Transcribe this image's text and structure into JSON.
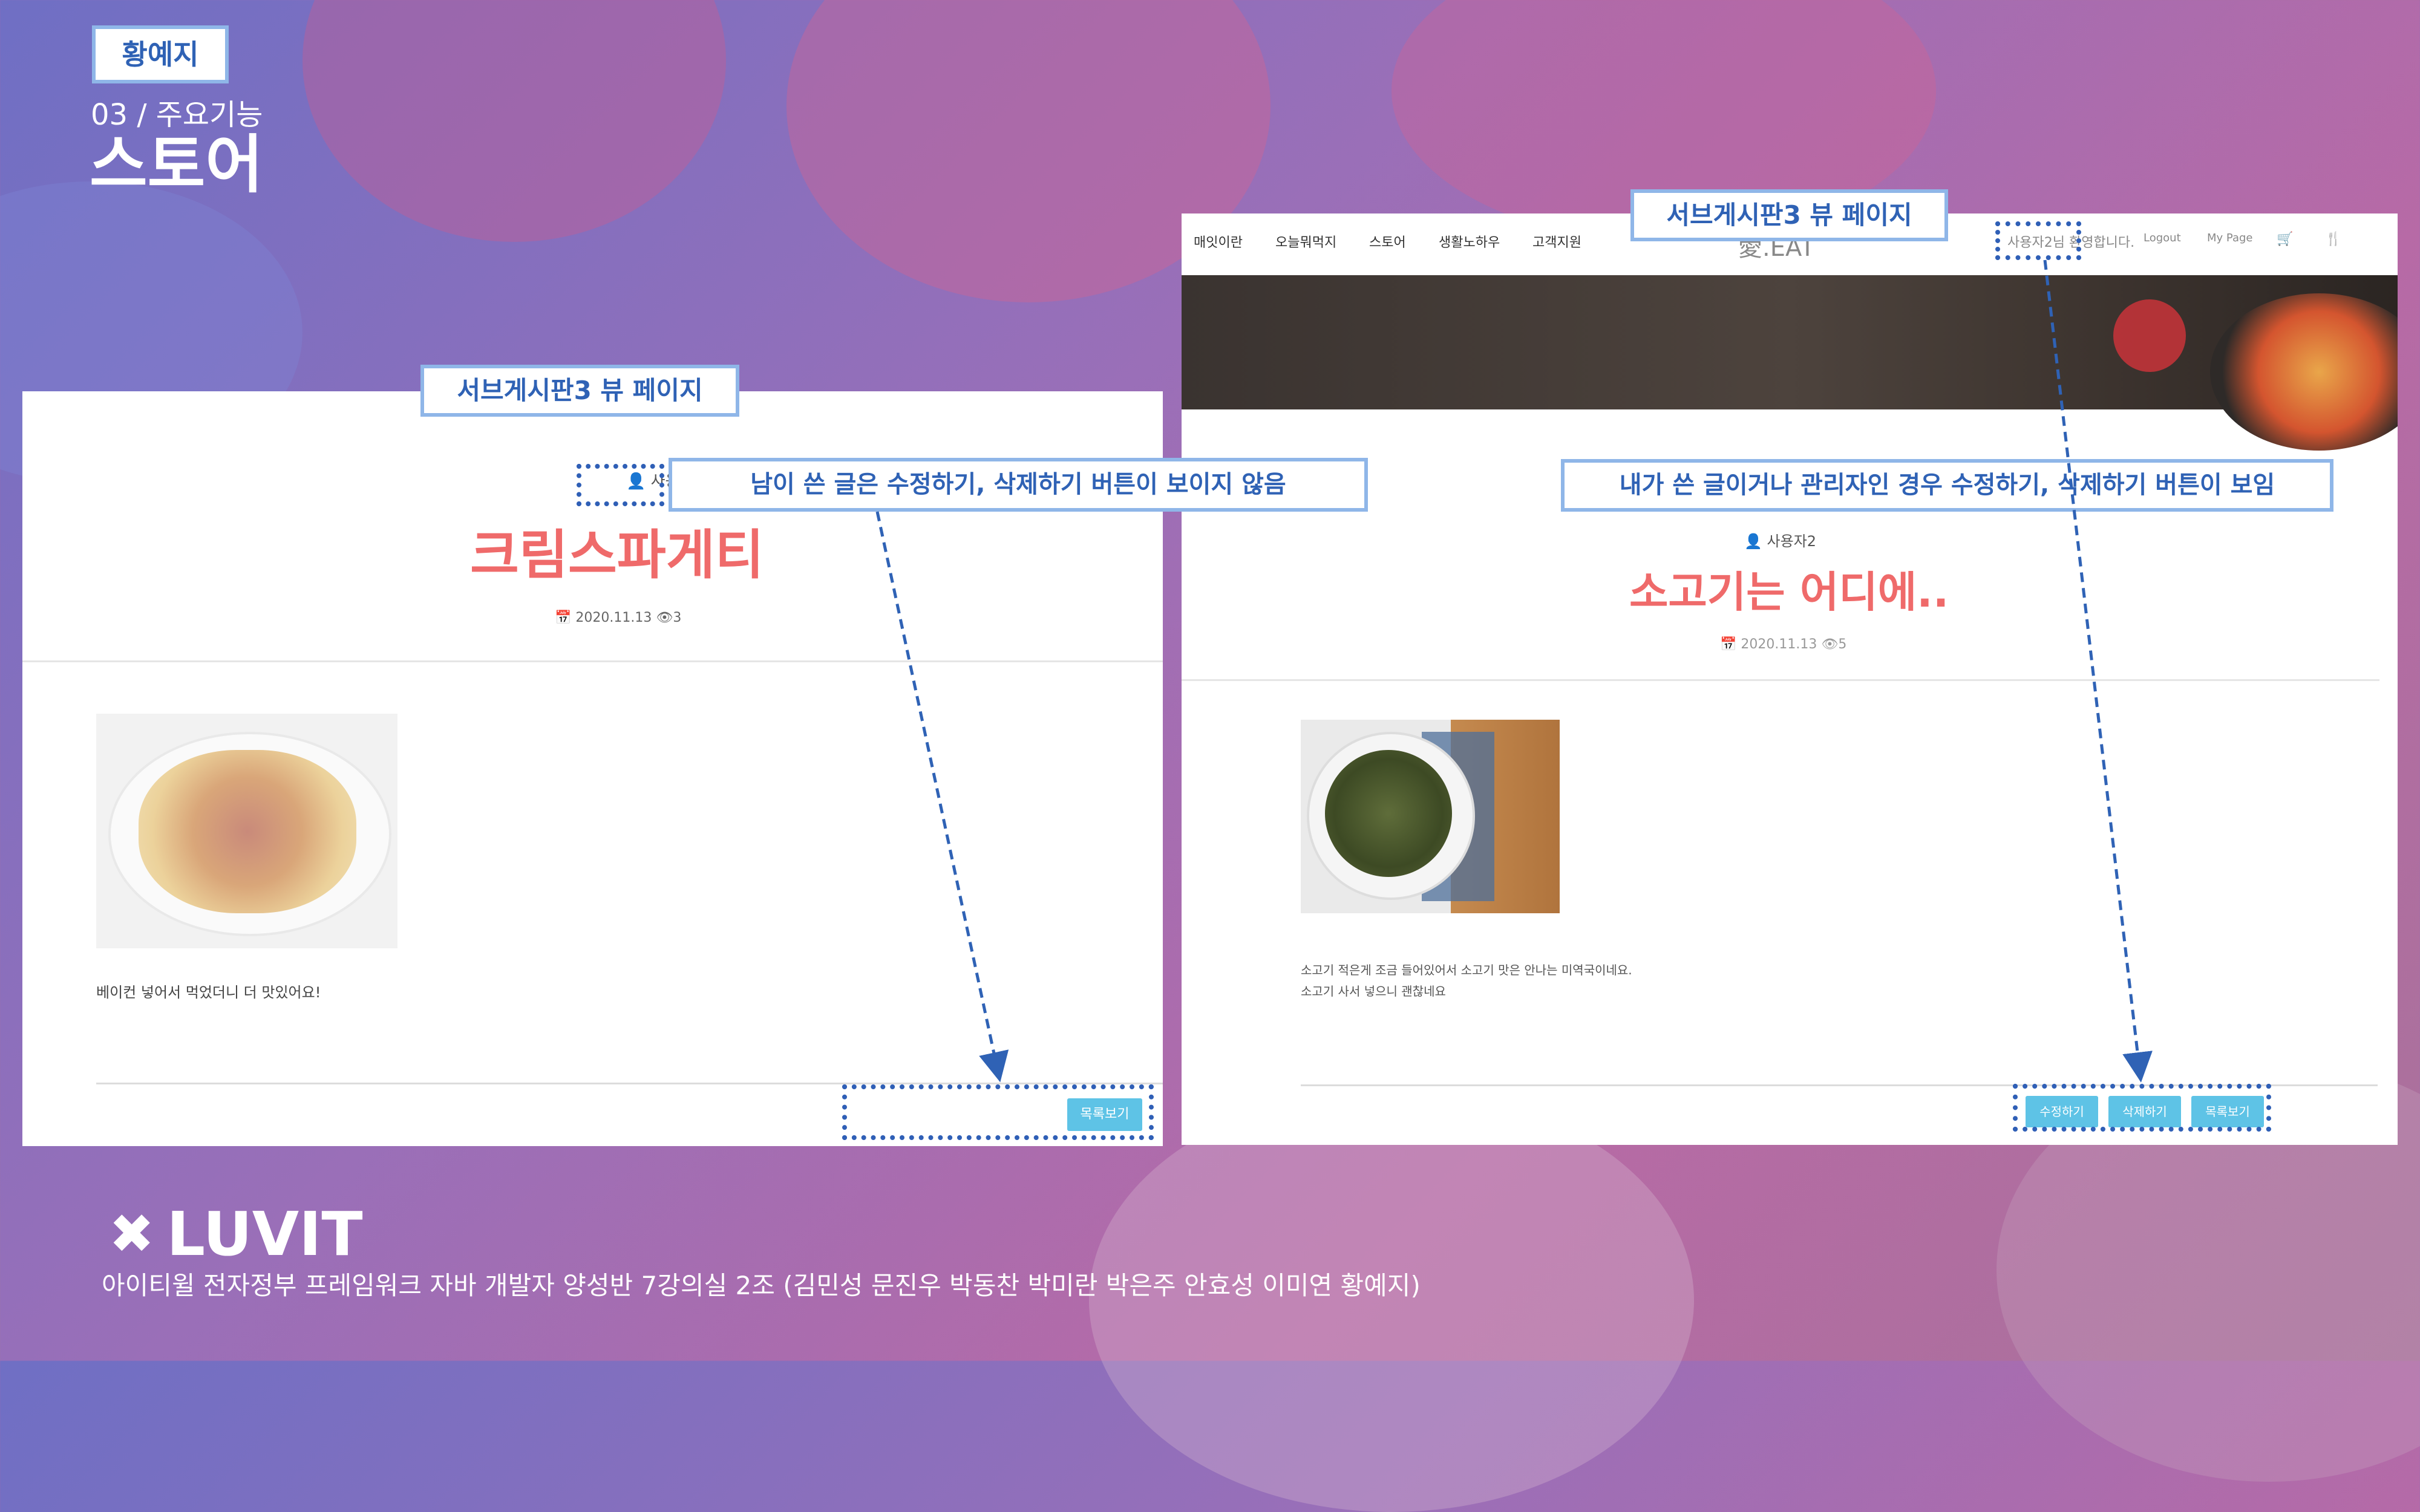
{
  "slide": {
    "author_tag": "황예지",
    "section": "03 / 주요기능",
    "title": "스토어",
    "footer_logo": "LUVIT",
    "footer_text": "아이티윌 전자정부 프레임워크 자바 개발자 양성반 7강의실 2조 (김민성 문진우 박동찬 박미란 박은주 안효성 이미연 황예지)"
  },
  "left_panel": {
    "label": "서브게시판3 뷰 페이지",
    "author": "사용자1",
    "post_title": "크림스파게티",
    "meta_date": "2020.11.13",
    "meta_views": "3",
    "body_text": "베이컨 넣어서 먹었더니 더 맛있어요!",
    "list_button": "목록보기",
    "callout": "남이 쓴 글은 수정하기, 삭제하기 버튼이 보이지 않음"
  },
  "right_panel": {
    "label": "서브게시판3 뷰 페이지",
    "nav_items": [
      "매잇이란",
      "오늘뭐먹지",
      "스토어",
      "생활노하우",
      "고객지원"
    ],
    "brand": "愛.EAT",
    "greeting": "사용자2님 환영합니다.",
    "logout": "Logout",
    "mypage": "My Page",
    "author": "사용자2",
    "post_title": "소고기는 어디에..",
    "meta_date": "2020.11.13",
    "meta_views": "5",
    "body_line1": "소고기 적은게 조금 들어있어서 소고기 맛은 안나는 미역국이네요.",
    "body_line2": "소고기 사서 넣으니 괜찮네요",
    "edit_button": "수정하기",
    "delete_button": "삭제하기",
    "list_button": "목록보기",
    "callout": "내가 쓴 글이거나 관리자인 경우 수정하기, 삭제하기 버튼이 보임"
  },
  "colors": {
    "accent_blue": "#2f62b5",
    "title_red": "#ef6a6a",
    "button_sky": "#5ec3e6"
  }
}
